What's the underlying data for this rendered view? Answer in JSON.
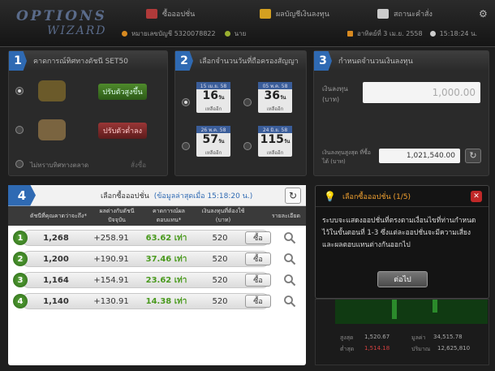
{
  "app": {
    "logo_line1": "OPTIONS",
    "logo_line2": "WIZARD"
  },
  "nav": {
    "tab1": "ซื้อออปชั่น",
    "tab2": "ผลบัญชีเงินลงทุน",
    "tab3": "สถานะคำสั่ง"
  },
  "account": {
    "label": "หมายเลขบัญชี 5320078822",
    "user": "นาย",
    "date": "อาทิตย์ที่ 3 เม.ย. 2558",
    "time": "15:18:24 น."
  },
  "step1": {
    "num": "1",
    "title": "คาดการณ์ทิศทางดัชนี SET50",
    "bull_label": "ปรับตัวสูงขึ้น",
    "bear_label": "ปรับตัวต่ำลง",
    "sideways_label": "ไม่ทราบทิศทางตลาด",
    "sideways_hint": "สั่งซื้อ"
  },
  "step2": {
    "num": "2",
    "title": "เลือกจำนวนวันที่ถือครองสัญญา",
    "options": [
      {
        "head": "15 เม.ย. 58",
        "days": "16",
        "unit": "วัน",
        "sub": "เหลืออีก"
      },
      {
        "head": "05 พ.ค. 58",
        "days": "36",
        "unit": "วัน",
        "sub": "เหลืออีก"
      },
      {
        "head": "26 พ.ค. 58",
        "days": "57",
        "unit": "วัน",
        "sub": "เหลืออีก"
      },
      {
        "head": "24 มิ.ย. 58",
        "days": "115",
        "unit": "วัน",
        "sub": "เหลืออีก"
      }
    ]
  },
  "step3": {
    "num": "3",
    "title": "กำหนดจำนวนเงินลงทุน",
    "invest_label": "เงินลงทุน (บาท)",
    "invest_value": "1,000.00",
    "max_label": "เงินลงทุนสูงสุด ที่ซื้อได้ (บาท)",
    "max_value": "1,021,540.00"
  },
  "step4": {
    "num": "4",
    "title": "เลือกซื้อออปชั่น",
    "updated": "(ข้อมูลล่าสุดเมื่อ 15:18:20 น.)",
    "columns": [
      "ดัชนีที่คุณคาดว่าจะถึง*",
      "ผลต่างกับดัชนีปัจจุบัน",
      "คาดการณ์ผลตอบแทน*",
      "เงินลงทุนที่ต้องใช้ (บาท)",
      "รายละเอียด"
    ],
    "rows": [
      {
        "num": "1",
        "target": "1,268",
        "diff": "+258.91",
        "ret": "63.62 เท่า",
        "cost": "520",
        "buy": "ซื้อ"
      },
      {
        "num": "2",
        "target": "1,200",
        "diff": "+190.91",
        "ret": "37.46 เท่า",
        "cost": "520",
        "buy": "ซื้อ"
      },
      {
        "num": "3",
        "target": "1,164",
        "diff": "+154.91",
        "ret": "23.62 เท่า",
        "cost": "520",
        "buy": "ซื้อ"
      },
      {
        "num": "4",
        "target": "1,140",
        "diff": "+130.91",
        "ret": "14.38 เท่า",
        "cost": "520",
        "buy": "ซื้อ"
      }
    ]
  },
  "tip": {
    "title": "เลือกซื้อออปชั่น (1/5)",
    "line1": "ระบบจะแสดงออปชั่นที่ตรงตามเงื่อนไขที่ท่านกำหนด",
    "line2": "ไว้ในขั้นตอนที่ 1-3 ซึ่งแต่ละออปชั่นจะมีความเสี่ยง",
    "line3": "และผลตอบแทนต่างกันออกไป",
    "next": "ต่อไป"
  },
  "chart_stats": {
    "high_label": "สูงสุด",
    "high": "1,520.67",
    "low_label": "ต่ำสุด",
    "low": "1,514.18",
    "vol_label": "มูลค่า",
    "vol": "34,515.78",
    "amt_label": "ปริมาณ",
    "amt": "12,625,810"
  }
}
